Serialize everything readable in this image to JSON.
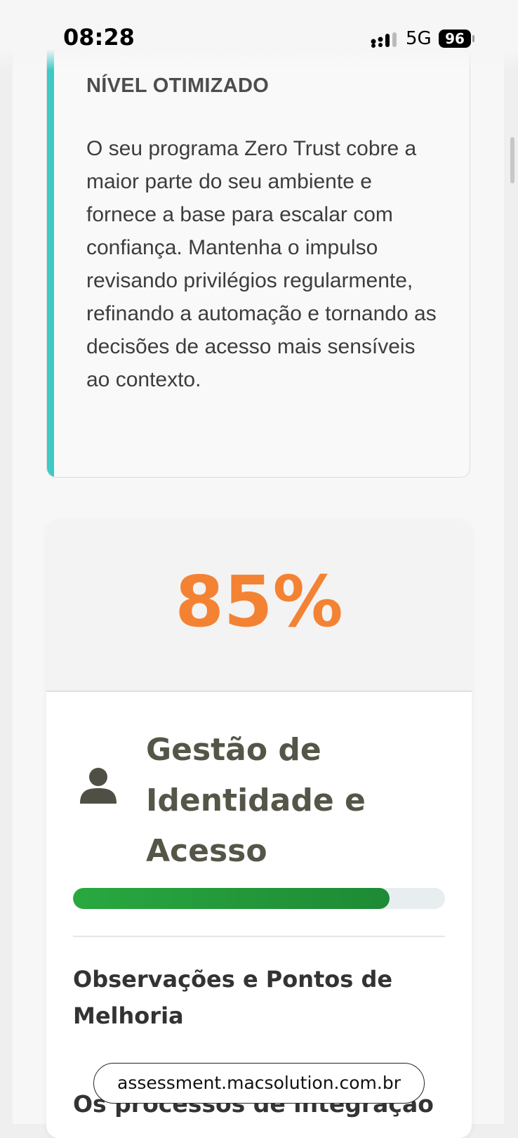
{
  "status_bar": {
    "time": "08:28",
    "network": "5G",
    "battery": "96"
  },
  "level_card": {
    "title": "NÍVEL OTIMIZADO",
    "description": "O seu programa Zero Trust cobre a maior parte do seu ambiente e fornece a base para escalar com confiança. Mantenha o impulso revisando privilégios regularmente, refinando a automação e tornando as decisões de acesso mais sensíveis ao contexto.",
    "accent_color": "#3ec9c5"
  },
  "score_card": {
    "score": "85%",
    "score_color": "#f48233",
    "icon": "user-icon",
    "category": "Gestão de Identidade e Acesso",
    "progress": 0.85,
    "progress_color": "#29a840",
    "observations_title": "Observações e Pontos de Melhoria",
    "observations_text": "Os processos de integração"
  },
  "browser": {
    "url": "assessment.macsolution.com.br"
  }
}
